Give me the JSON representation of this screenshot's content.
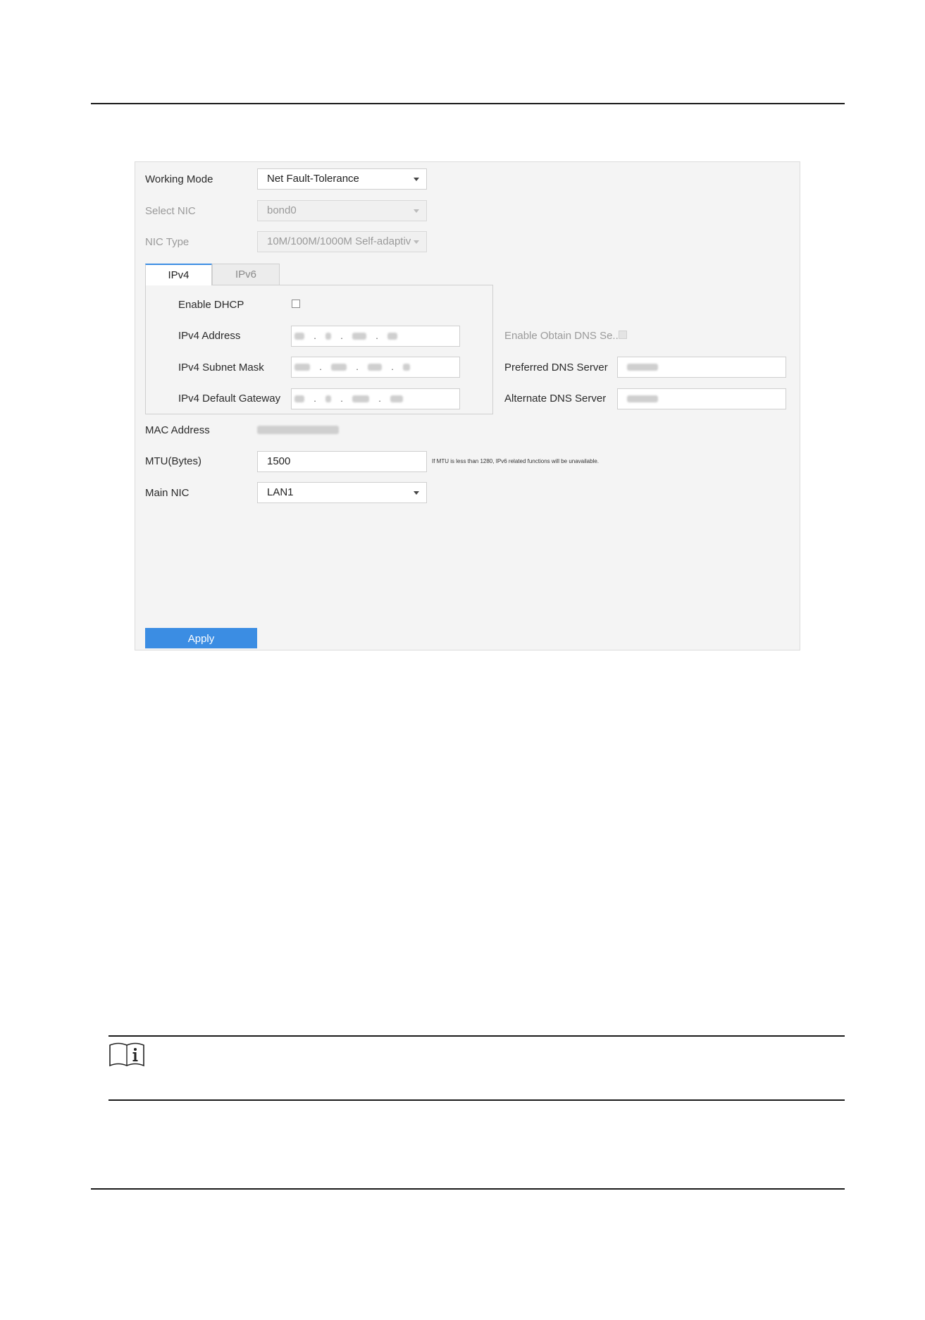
{
  "form": {
    "working_mode": {
      "label": "Working Mode",
      "value": "Net Fault-Tolerance"
    },
    "select_nic": {
      "label": "Select NIC",
      "value": "bond0"
    },
    "nic_type": {
      "label": "NIC Type",
      "value": "10M/100M/1000M Self-adaptiv"
    },
    "tabs": [
      {
        "label": "IPv4",
        "active": true
      },
      {
        "label": "IPv6",
        "active": false
      }
    ],
    "ipv4": {
      "enable_dhcp_label": "Enable DHCP",
      "enable_dhcp_checked": false,
      "address_label": "IPv4 Address",
      "subnet_mask_label": "IPv4 Subnet Mask",
      "gateway_label": "IPv4 Default Gateway",
      "dot": "."
    },
    "dns": {
      "enable_obtain_label": "Enable Obtain DNS Se...",
      "preferred_label": "Preferred DNS Server",
      "alternate_label": "Alternate DNS Server"
    },
    "mac_address_label": "MAC Address",
    "mtu": {
      "label": "MTU(Bytes)",
      "value": "1500",
      "hint": "If MTU is less than 1280, IPv6 related functions will be unavailable."
    },
    "main_nic": {
      "label": "Main NIC",
      "value": "LAN1"
    },
    "apply_label": "Apply"
  },
  "colors": {
    "accent": "#3b8de3",
    "panel_bg": "#f4f4f4",
    "border": "#cfcfcf"
  },
  "icons": {
    "note": "note-book-info-icon",
    "dropdown": "caret-down-icon"
  }
}
